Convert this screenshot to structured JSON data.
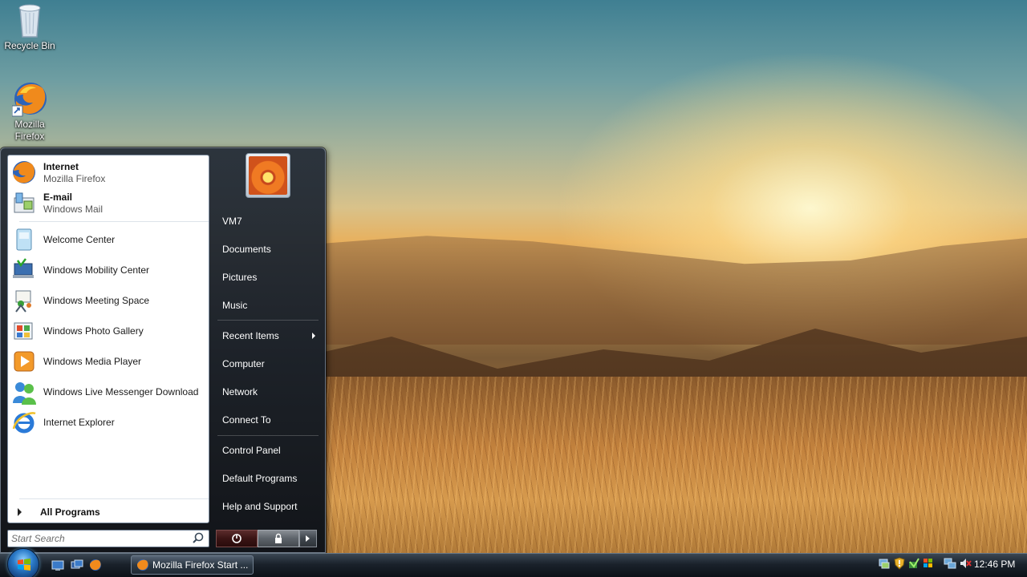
{
  "desktop": {
    "icons": [
      {
        "label": "Recycle Bin"
      },
      {
        "label": "Mozilla Firefox"
      }
    ]
  },
  "start_menu": {
    "pinned": [
      {
        "title": "Internet",
        "subtitle": "Mozilla Firefox",
        "icon": "firefox-icon"
      },
      {
        "title": "E-mail",
        "subtitle": "Windows Mail",
        "icon": "mail-icon"
      }
    ],
    "recent_programs": [
      {
        "label": "Welcome Center",
        "icon": "welcome-center-icon"
      },
      {
        "label": "Windows Mobility Center",
        "icon": "mobility-center-icon"
      },
      {
        "label": "Windows Meeting Space",
        "icon": "meeting-space-icon"
      },
      {
        "label": "Windows Photo Gallery",
        "icon": "photo-gallery-icon"
      },
      {
        "label": "Windows Media Player",
        "icon": "media-player-icon"
      },
      {
        "label": "Windows Live Messenger Download",
        "icon": "messenger-icon"
      },
      {
        "label": "Internet Explorer",
        "icon": "internet-explorer-icon"
      }
    ],
    "all_programs": "All Programs",
    "search_placeholder": "Start Search",
    "right_items": [
      {
        "label": "VM7"
      },
      {
        "label": "Documents"
      },
      {
        "label": "Pictures"
      },
      {
        "label": "Music"
      },
      {
        "label": "Recent Items",
        "has_submenu": true
      },
      {
        "label": "Computer"
      },
      {
        "label": "Network"
      },
      {
        "label": "Connect To"
      },
      {
        "label": "Control Panel"
      },
      {
        "label": "Default Programs"
      },
      {
        "label": "Help and Support"
      }
    ]
  },
  "taskbar": {
    "task_button": "Mozilla Firefox Start ...",
    "clock": "12:46 PM"
  },
  "colors": {
    "accent": "#2a7ac8",
    "menu_dark": "#1b222b"
  }
}
